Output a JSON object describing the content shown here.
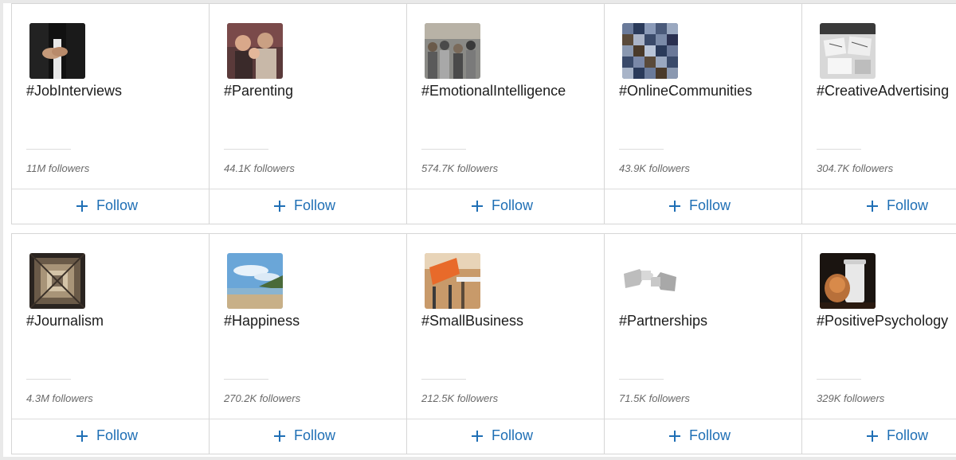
{
  "follow_label": "Follow",
  "rows": [
    {
      "cards": [
        {
          "tag": "#JobInterviews",
          "followers": "11M followers",
          "thumb": "handshake-photo-thumbnail"
        },
        {
          "tag": "#Parenting",
          "followers": "44.1K followers",
          "thumb": "family-photo-thumbnail"
        },
        {
          "tag": "#EmotionalIntelligence",
          "followers": "574.7K followers",
          "thumb": "crowd-photo-thumbnail"
        },
        {
          "tag": "#OnlineCommunities",
          "followers": "43.9K followers",
          "thumb": "people-mosaic-thumbnail"
        },
        {
          "tag": "#CreativeAdvertising",
          "followers": "304.7K followers",
          "thumb": "desk-sketches-thumbnail"
        }
      ]
    },
    {
      "cards": [
        {
          "tag": "#Journalism",
          "followers": "4.3M followers",
          "thumb": "newspapers-thumbnail"
        },
        {
          "tag": "#Happiness",
          "followers": "270.2K followers",
          "thumb": "beach-sky-thumbnail"
        },
        {
          "tag": "#SmallBusiness",
          "followers": "212.5K followers",
          "thumb": "office-chair-thumbnail"
        },
        {
          "tag": "#Partnerships",
          "followers": "71.5K followers",
          "thumb": "puzzle-hands-thumbnail"
        },
        {
          "tag": "#PositivePsychology",
          "followers": "329K followers",
          "thumb": "coffee-cup-thumbnail"
        }
      ]
    }
  ],
  "colors": {
    "accent": "#1f6fb5",
    "text": "#1c1c1c",
    "muted": "#6a6a6a",
    "border": "#d6d6d6"
  }
}
